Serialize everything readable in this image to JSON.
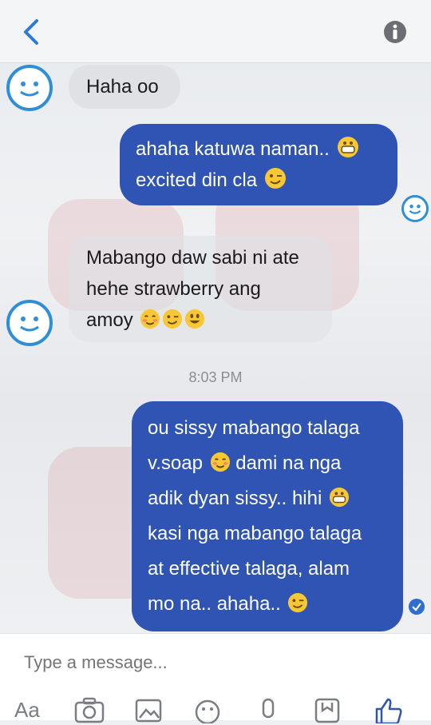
{
  "header": {
    "back_icon": "chevron-left-icon",
    "info_icon": "info-icon"
  },
  "messages": [
    {
      "side": "in",
      "lines": [
        "Haha oo"
      ]
    },
    {
      "side": "out",
      "lines": [
        "ahaha katuwa naman..",
        "excited din cla"
      ]
    },
    {
      "side": "in",
      "lines": [
        "Mabango daw sabi ni ate",
        "hehe strawberry ang",
        "amoy"
      ]
    },
    {
      "side": "out",
      "lines": [
        "ou sissy mabango talaga",
        "v.soap",
        "dami na nga",
        "adik dyan sissy.. hihi",
        "kasi nga mabango talaga",
        "at effective talaga, alam",
        "mo na.. ahaha.."
      ]
    }
  ],
  "timestamp": "8:03 PM",
  "composer": {
    "placeholder": "Type a message...",
    "aa_label": "Aa",
    "tools": [
      "text-format-icon",
      "camera-icon",
      "gallery-icon",
      "emoji-icon",
      "microphone-icon",
      "sticker-icon",
      "thumbs-up-icon"
    ]
  },
  "colors": {
    "outgoing": "#2f54b4",
    "incoming": "#dfe1e5",
    "accent": "#2e8fd8"
  }
}
